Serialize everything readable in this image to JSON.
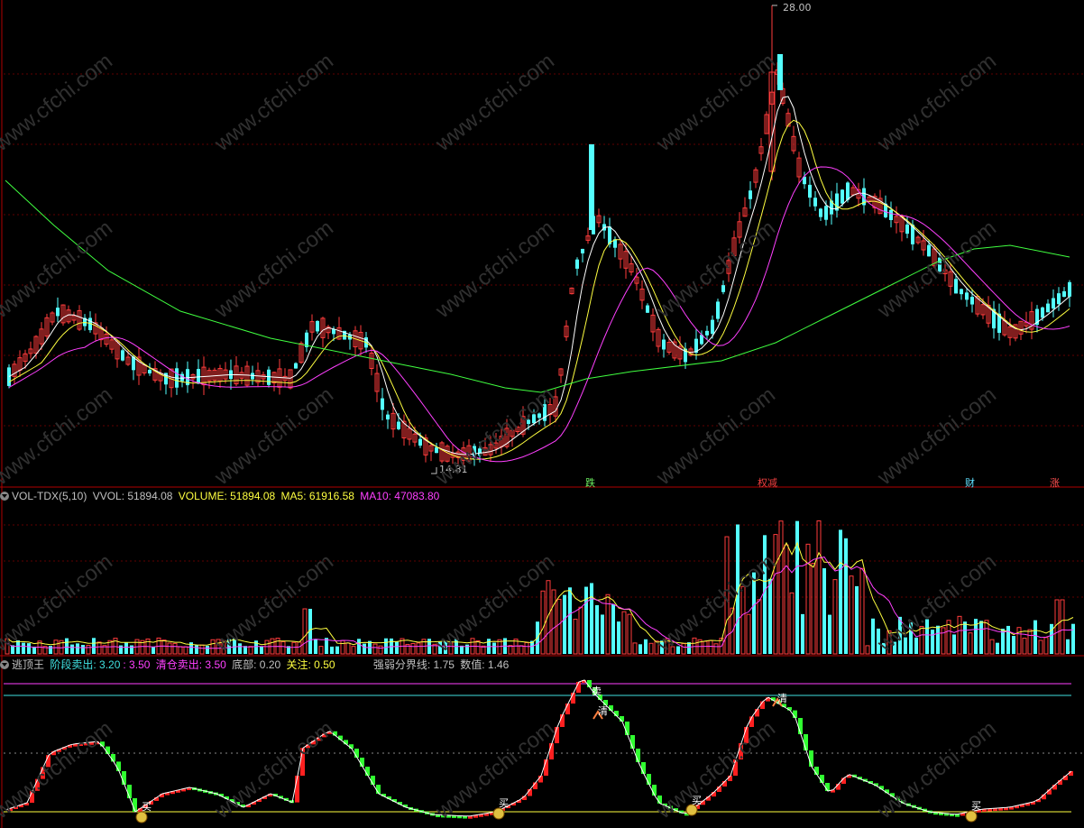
{
  "price_panel": {
    "high_label": "28.00",
    "low_label": "14.81",
    "markers": [
      {
        "text": "跌",
        "color": "#6cf060"
      },
      {
        "text": "权减",
        "color": "#f04040"
      },
      {
        "text": "财",
        "color": "#60e0ff"
      },
      {
        "text": "涨",
        "color": "#ff5050"
      }
    ]
  },
  "volume_panel": {
    "indicator": "VOL-TDX(5,10)",
    "vvol": "VVOL: 51894.08",
    "volume": "VOLUME: 51894.08",
    "ma5": "MA5: 61916.58",
    "ma10": "MA10: 47083.80"
  },
  "escape_panel": {
    "name": "逃顶王",
    "stage_sell": "阶段卖出: 3.20",
    "stage_sell_2": ": 3.50",
    "clear_sell": "清仓卖出: 3.50",
    "bottom": "底部: 0.20",
    "watch": "关注: 0.50",
    "strength": "强弱分界线: 1.75",
    "value": "数值: 1.46",
    "signal_sell": "卖",
    "signal_clear": "清",
    "signal_buy": "买"
  },
  "colors": {
    "up": "#ff3c3c",
    "down": "#54ffff",
    "ma5": "#ffffff",
    "ma10": "#ffff40",
    "ma20": "#ff40ff",
    "ma60": "#40ff40"
  },
  "watermark": "www.cfchi.com"
}
